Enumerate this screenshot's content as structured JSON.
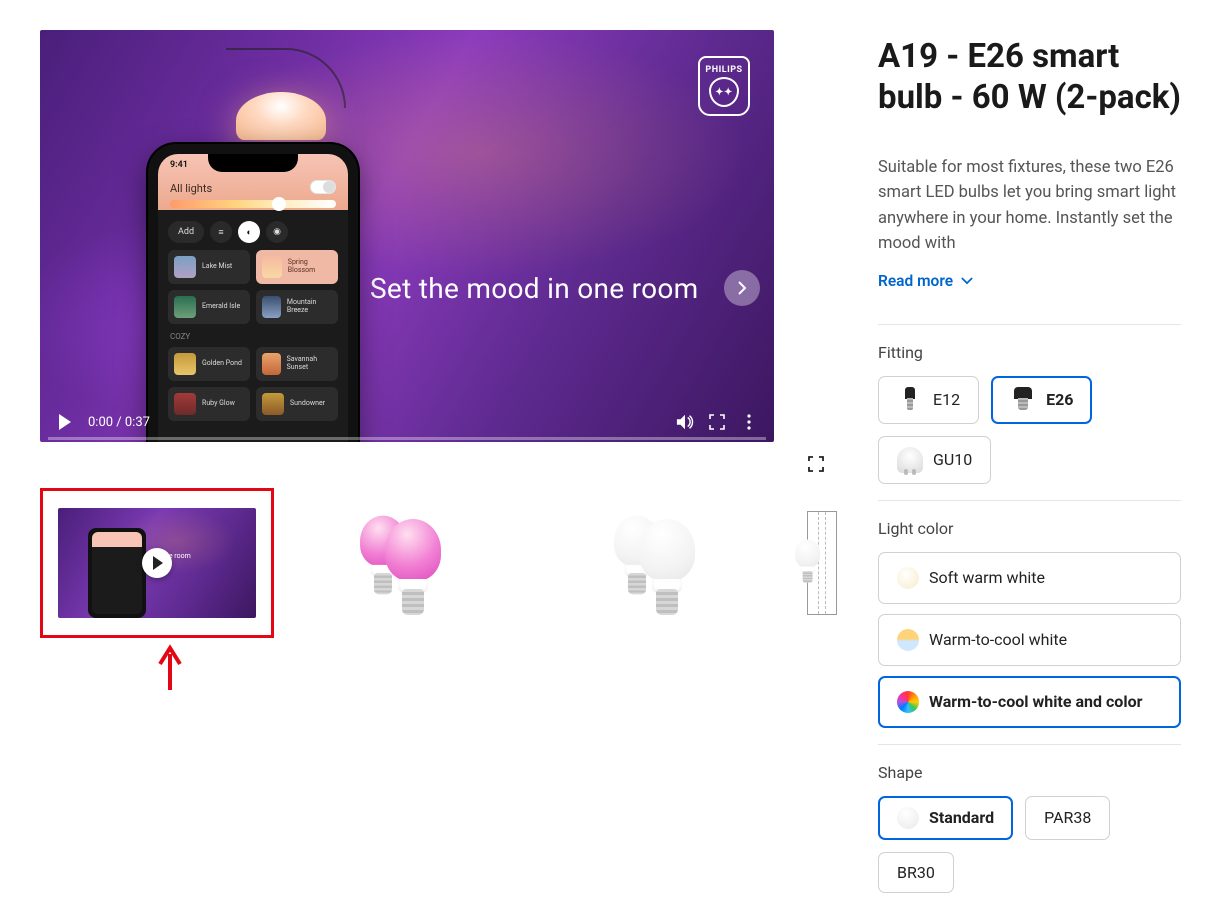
{
  "product": {
    "title": "A19 - E26 smart bulb - 60 W (2-pack)",
    "description": "Suitable for most fixtures, these two E26 smart LED bulbs let you bring smart light anywhere in your home. Instantly set the mood with",
    "read_more_label": "Read more"
  },
  "video": {
    "brand": "PHILIPS",
    "overlay_text": "Set the mood in one room",
    "time_display": "0:00 / 0:37",
    "phone_status_time": "9:41",
    "phone_header": "All lights",
    "phone_add": "Add",
    "tiles": [
      {
        "label": "Lake Mist"
      },
      {
        "label": "Spring Blossom"
      },
      {
        "label": "Emerald Isle"
      },
      {
        "label": "Mountain Breeze"
      }
    ],
    "cozy_heading": "COZY",
    "cozy_tiles": [
      {
        "label": "Golden Pond"
      },
      {
        "label": "Savannah Sunset"
      },
      {
        "label": "Ruby Glow"
      },
      {
        "label": "Sundowner"
      }
    ],
    "thumb_caption": "d in one room"
  },
  "options": {
    "fitting": {
      "label": "Fitting",
      "items": [
        {
          "id": "E12",
          "selected": false
        },
        {
          "id": "E26",
          "selected": true
        },
        {
          "id": "GU10",
          "selected": false
        }
      ]
    },
    "light_color": {
      "label": "Light color",
      "items": [
        {
          "label": "Soft warm white",
          "selected": false
        },
        {
          "label": "Warm-to-cool white",
          "selected": false
        },
        {
          "label": "Warm-to-cool white and color",
          "selected": true
        }
      ]
    },
    "shape": {
      "label": "Shape",
      "items": [
        {
          "label": "Standard",
          "selected": true
        },
        {
          "label": "PAR38",
          "selected": false
        },
        {
          "label": "BR30",
          "selected": false
        }
      ]
    }
  }
}
